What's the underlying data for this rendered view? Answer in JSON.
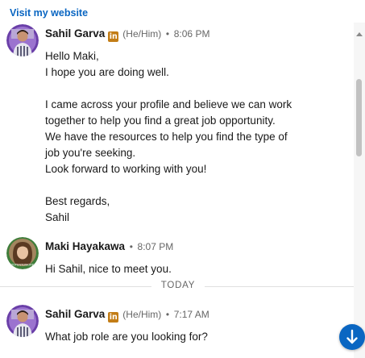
{
  "header": {
    "link_label": "Visit my website"
  },
  "messages": [
    {
      "sender": "Sahil Garva",
      "linkedin_badge": "in",
      "pronouns": "(He/Him)",
      "separator": "•",
      "time": "8:06 PM",
      "lines": [
        "Hello Maki,",
        "I hope you are doing well.",
        "",
        "I came across your profile and believe we can work",
        "together to help you find a great job opportunity.",
        "We have the resources to help you find the type of",
        "job you're seeking.",
        "Look forward to working with you!",
        "",
        "Best regards,",
        "Sahil"
      ]
    },
    {
      "sender": "Maki Hayakawa",
      "separator": "•",
      "time": "8:07 PM",
      "lines": [
        "Hi Sahil, nice to meet you."
      ]
    },
    {
      "sender": "Sahil Garva",
      "linkedin_badge": "in",
      "pronouns": "(He/Him)",
      "separator": "•",
      "time": "7:17 AM",
      "lines": [
        "What job role are you looking for?"
      ]
    }
  ],
  "divider": {
    "label": "TODAY"
  },
  "icons": {
    "avatar_sahil": "avatar-sahil",
    "avatar_maki": "avatar-maki",
    "linkedin": "linkedin-icon",
    "jump": "arrow-down-icon"
  },
  "colors": {
    "link": "#0a66c2",
    "linkedin_badge": "#c37d16",
    "jump_button": "#0a66c2",
    "muted_text": "#666666"
  }
}
